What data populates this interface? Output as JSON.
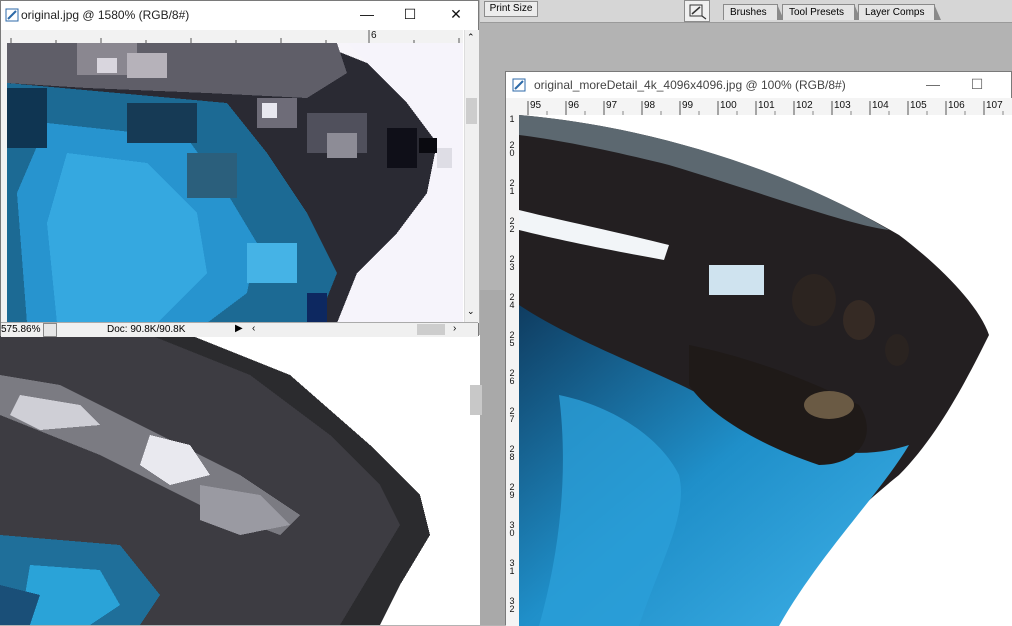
{
  "options_bar": {
    "print_size_label": "Print Size"
  },
  "palette_tabs": [
    "Brushes",
    "Tool Presets",
    "Layer Comps"
  ],
  "left_window": {
    "title": "original.jpg @ 1580% (RGB/8#)",
    "ruler_h_label": "6",
    "zoom_text": "575.86%",
    "doc_info": "Doc: 90.8K/90.8K"
  },
  "right_window": {
    "title": "original_moreDetail_4k_4096x4096.jpg @ 100% (RGB/8#)",
    "ruler_h_labels": [
      "95",
      "96",
      "97",
      "98",
      "99",
      "100",
      "101",
      "102",
      "103",
      "104",
      "105",
      "106",
      "107"
    ],
    "ruler_v_labels": [
      "1",
      "2 0",
      "2 1",
      "2 2",
      "2 3",
      "2 4",
      "2 5",
      "2 6",
      "2 7",
      "2 8",
      "2 9",
      "3 0",
      "3 1",
      "3 2"
    ]
  },
  "icons": {
    "minimize": "minimize-icon",
    "maximize": "maximize-icon",
    "close": "close-icon",
    "app": "photoshop-doc-icon"
  },
  "colors": {
    "wing_blue": "#1f8fc9",
    "wing_black": "#1a1818",
    "ui_grey": "#b3b3b3"
  }
}
